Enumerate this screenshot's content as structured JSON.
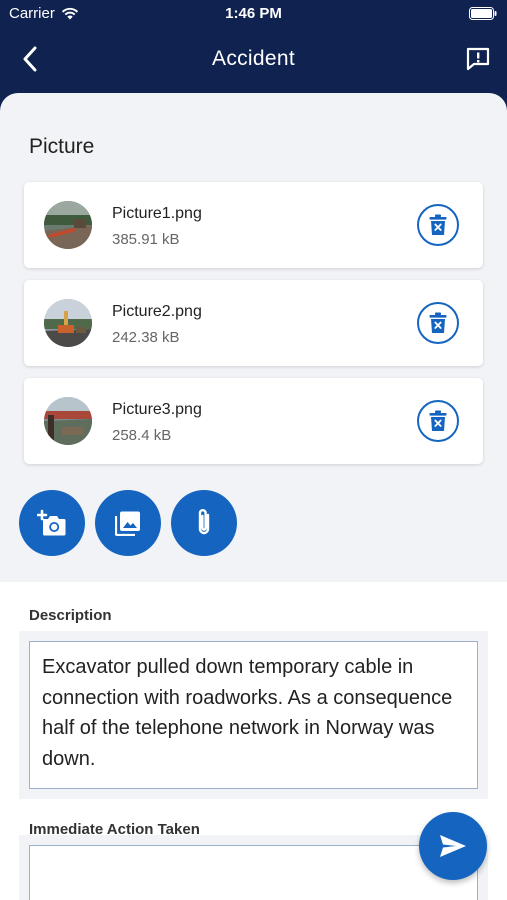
{
  "status_bar": {
    "carrier": "Carrier",
    "time": "1:46 PM"
  },
  "nav": {
    "title": "Accident",
    "back_icon": "chevron-left-icon",
    "report_icon": "report-icon"
  },
  "pictures": {
    "section_title": "Picture",
    "files": [
      {
        "name": "Picture1.png",
        "size": "385.91 kB"
      },
      {
        "name": "Picture2.png",
        "size": "242.38 kB"
      },
      {
        "name": "Picture3.png",
        "size": "258.4 kB"
      }
    ],
    "actions": [
      "add-photo-icon",
      "gallery-icon",
      "attachment-icon"
    ]
  },
  "description": {
    "label": "Description",
    "value": "Excavator pulled down temporary cable in connection with roadworks. As a consequence half of the telephone network in Norway was down."
  },
  "immediate_action": {
    "label": "Immediate Action Taken",
    "value": ""
  },
  "colors": {
    "header": "#0f2250",
    "accent": "#1565c0",
    "background": "#f1f3f7"
  }
}
